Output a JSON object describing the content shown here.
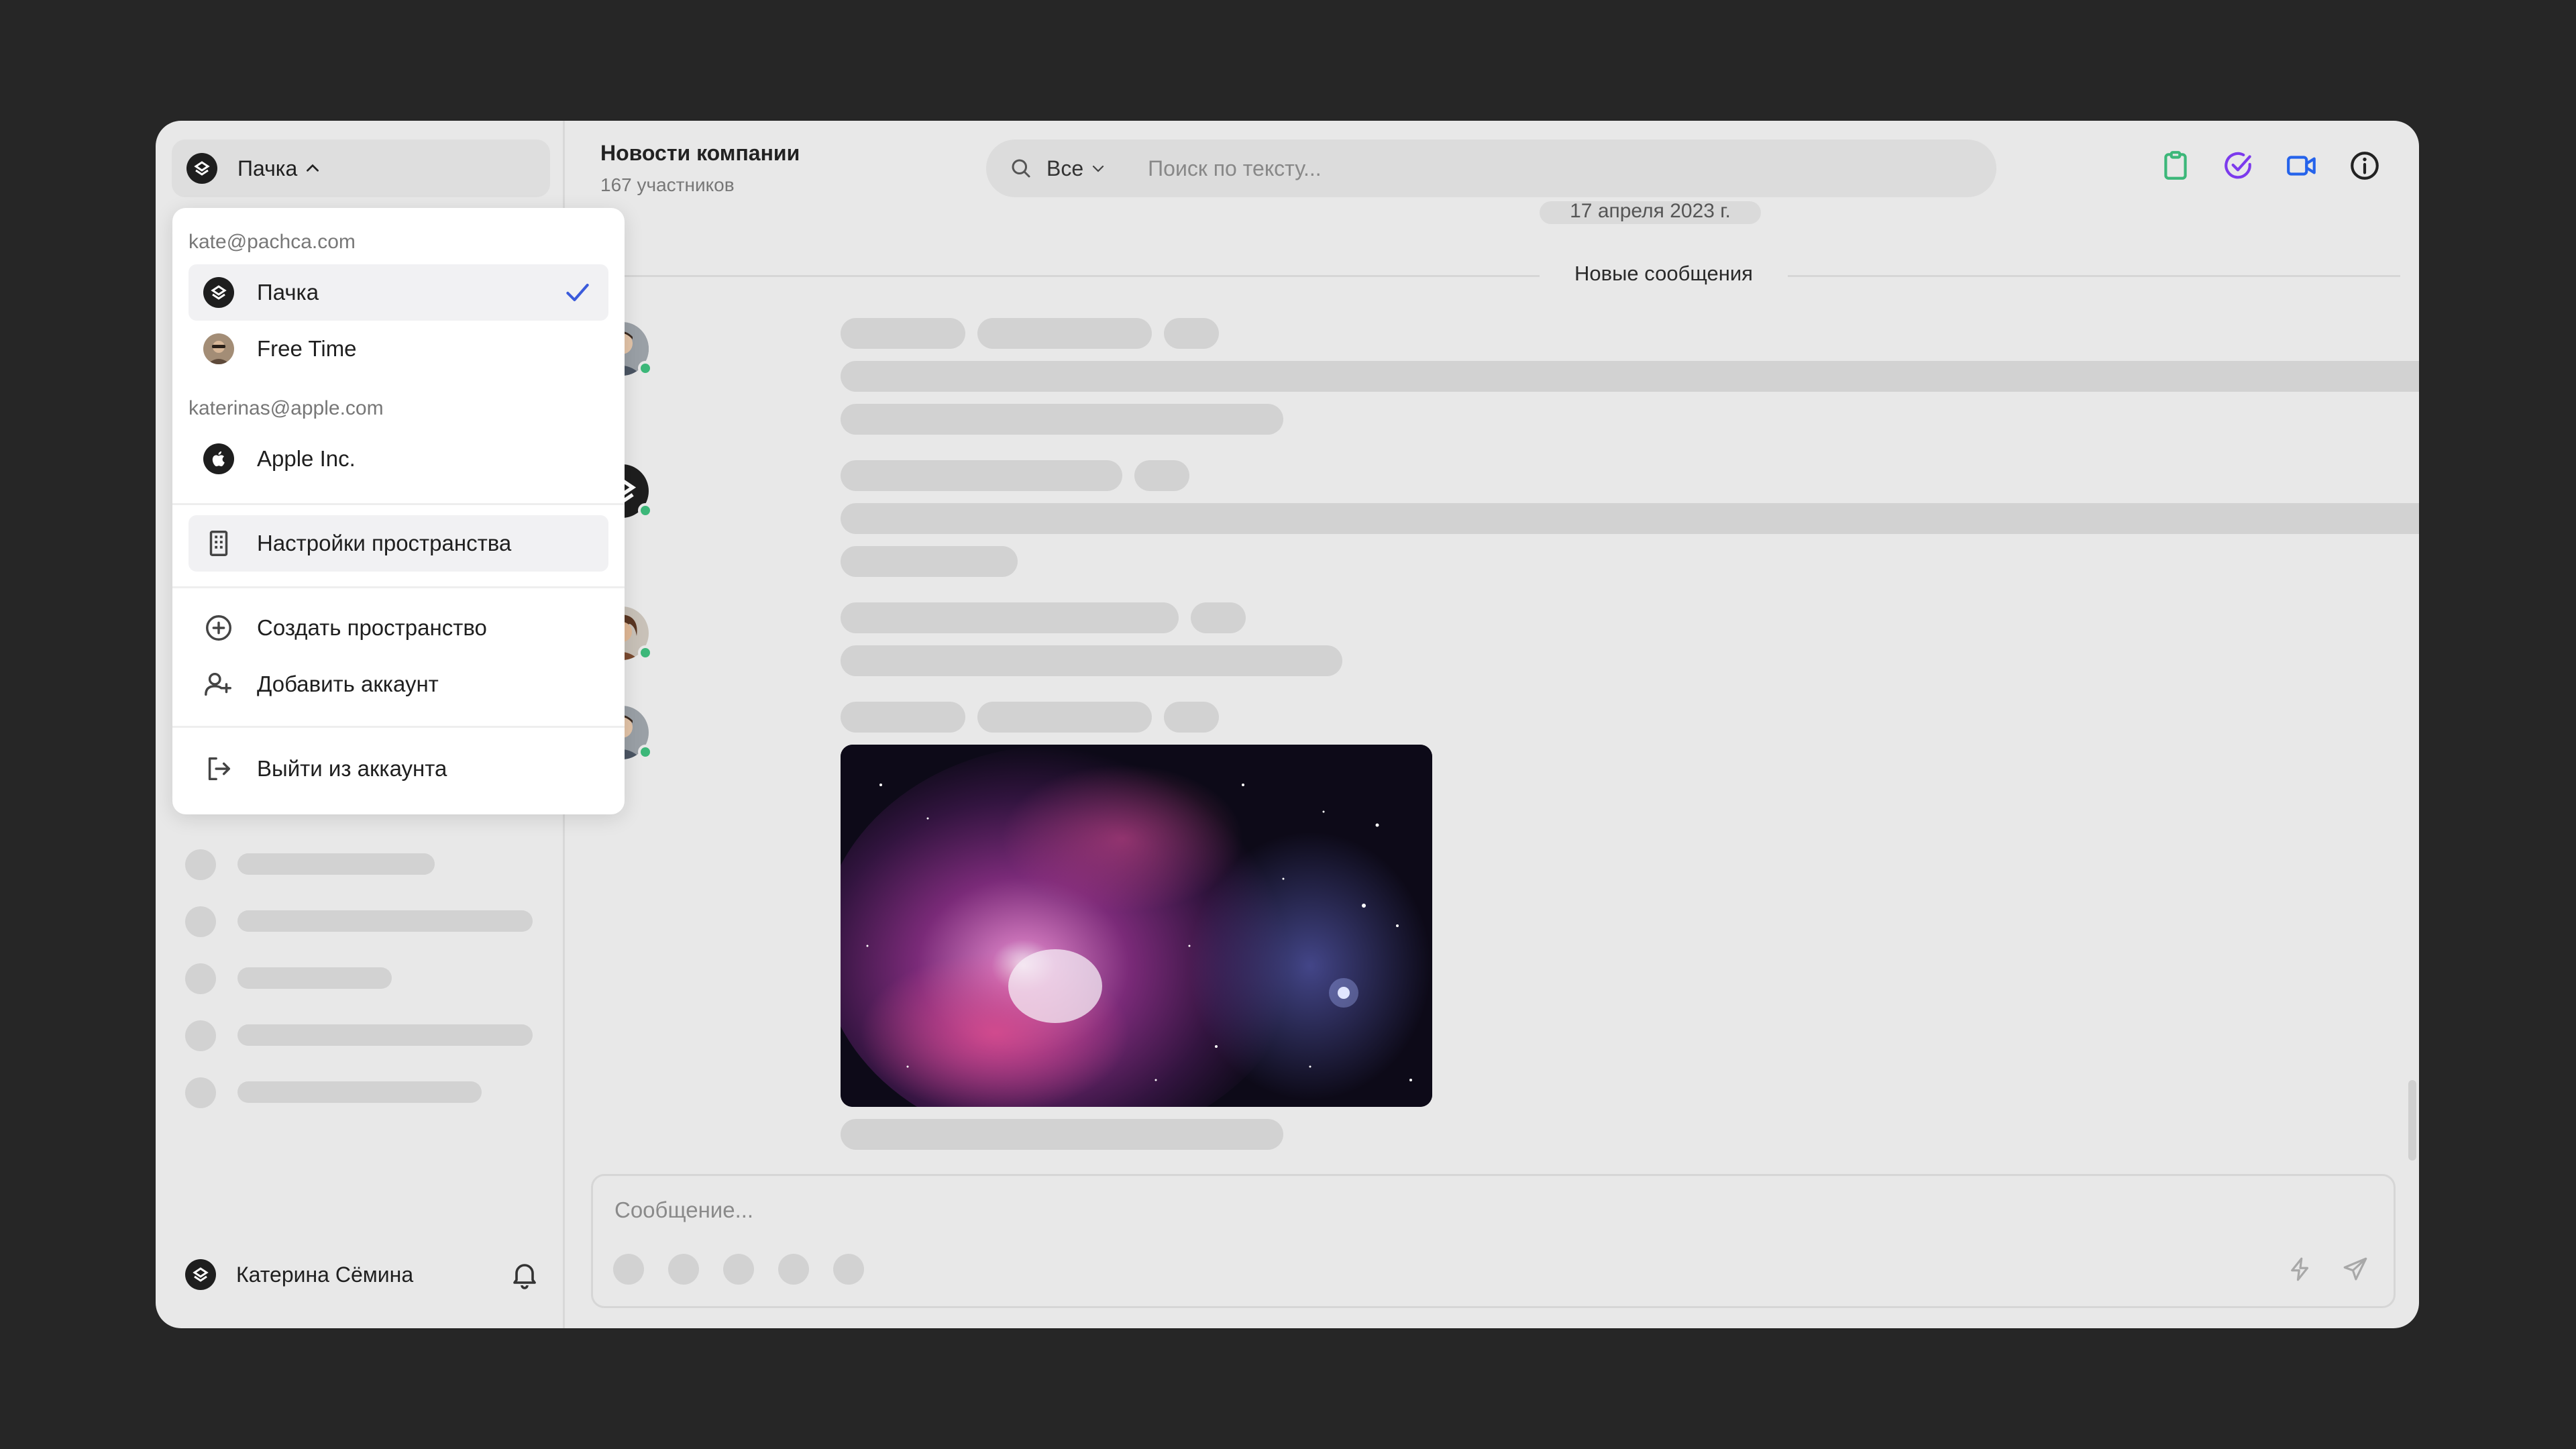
{
  "sidebar": {
    "workspace_name": "Пачка",
    "footer_user": "Катерина Сёмина"
  },
  "header": {
    "title": "Новости компании",
    "subtitle": "167 участников",
    "search_filter": "Все",
    "search_placeholder": "Поиск по тексту..."
  },
  "feed": {
    "date": "17 апреля 2023 г.",
    "new_messages": "Новые сообщения"
  },
  "composer": {
    "placeholder": "Сообщение..."
  },
  "menu": {
    "account1_email": "kate@pachca.com",
    "account1_spaces": [
      "Пачка",
      "Free Time"
    ],
    "account2_email": "katerinas@apple.com",
    "account2_spaces": [
      "Apple Inc."
    ],
    "space_settings": "Настройки пространства",
    "create_space": "Создать пространство",
    "add_account": "Добавить аккаунт",
    "logout": "Выйти из аккаунта"
  },
  "colors": {
    "online": "#3cb779",
    "check": "#3b5bdb",
    "clipboard_icon": "#3cb779",
    "tasks_icon": "#7c3aed",
    "video_icon": "#2563eb"
  },
  "icons": [
    "search-icon",
    "clipboard-icon",
    "check-circle-icon",
    "video-icon",
    "info-icon",
    "bell-icon",
    "lightning-icon",
    "send-icon",
    "building-icon",
    "plus-circle-icon",
    "user-plus-icon",
    "logout-icon",
    "check-icon"
  ]
}
